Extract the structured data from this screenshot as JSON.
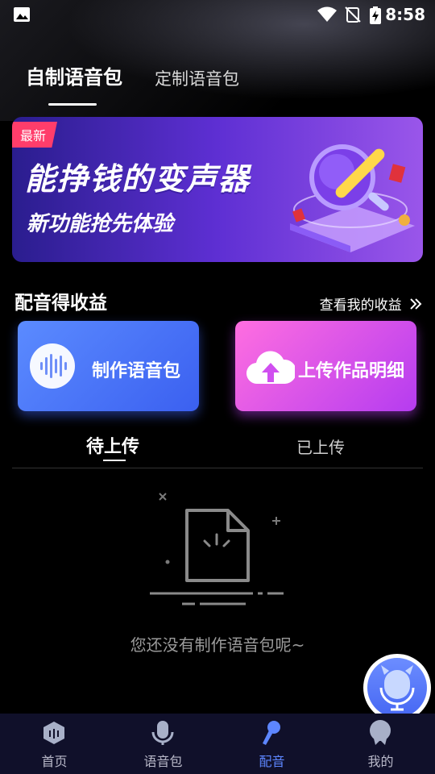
{
  "status_bar": {
    "time": "8:58"
  },
  "top_tabs": {
    "active": "自制语音包",
    "inactive": "定制语音包"
  },
  "banner": {
    "badge": "最新",
    "title": "能挣钱的变声器",
    "subtitle": "新功能抢先体验"
  },
  "section": {
    "title": "配音得收益",
    "link": "查看我的收益"
  },
  "cards": {
    "make": "制作语音包",
    "upload": "上传作品明细"
  },
  "sub_tabs": {
    "pending": "待上传",
    "uploaded": "已上传"
  },
  "empty_state": {
    "message": "您还没有制作语音包呢~"
  },
  "bottom_nav": {
    "items": [
      {
        "label": "首页"
      },
      {
        "label": "语音包"
      },
      {
        "label": "配音"
      },
      {
        "label": "我的"
      }
    ],
    "active_color": "#5d86ff"
  },
  "colors": {
    "card_blue": "#4a74f6",
    "card_pink": "#e25bea",
    "badge": "#ff3d6b"
  }
}
